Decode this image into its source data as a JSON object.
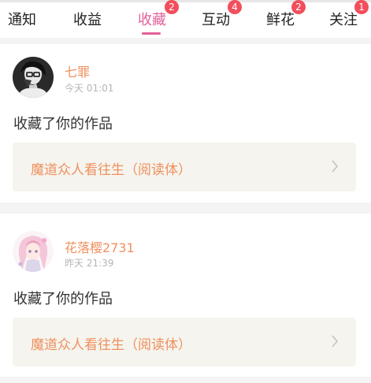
{
  "tabs": [
    {
      "label": "通知",
      "badge": ""
    },
    {
      "label": "收益",
      "badge": ""
    },
    {
      "label": "收藏",
      "badge": "2"
    },
    {
      "label": "互动",
      "badge": "4"
    },
    {
      "label": "鲜花",
      "badge": "2"
    },
    {
      "label": "关注",
      "badge": "1"
    }
  ],
  "active_tab": "收藏",
  "colors": {
    "accent": "#e3609a",
    "badge": "#f24e5c",
    "name": "#f0905e",
    "work_bg": "#f5f4ee"
  },
  "notifications": [
    {
      "user_name": "七罪",
      "time": "今天 01:01",
      "action": "收藏了你的作品",
      "work_title": "魔道众人看往生（阅读体）",
      "avatar_icon": "dark-portrait-avatar"
    },
    {
      "user_name": "花落樱2731",
      "time": "昨天 21:39",
      "action": "收藏了你的作品",
      "work_title": "魔道众人看往生（阅读体）",
      "avatar_icon": "anime-girl-avatar"
    }
  ]
}
